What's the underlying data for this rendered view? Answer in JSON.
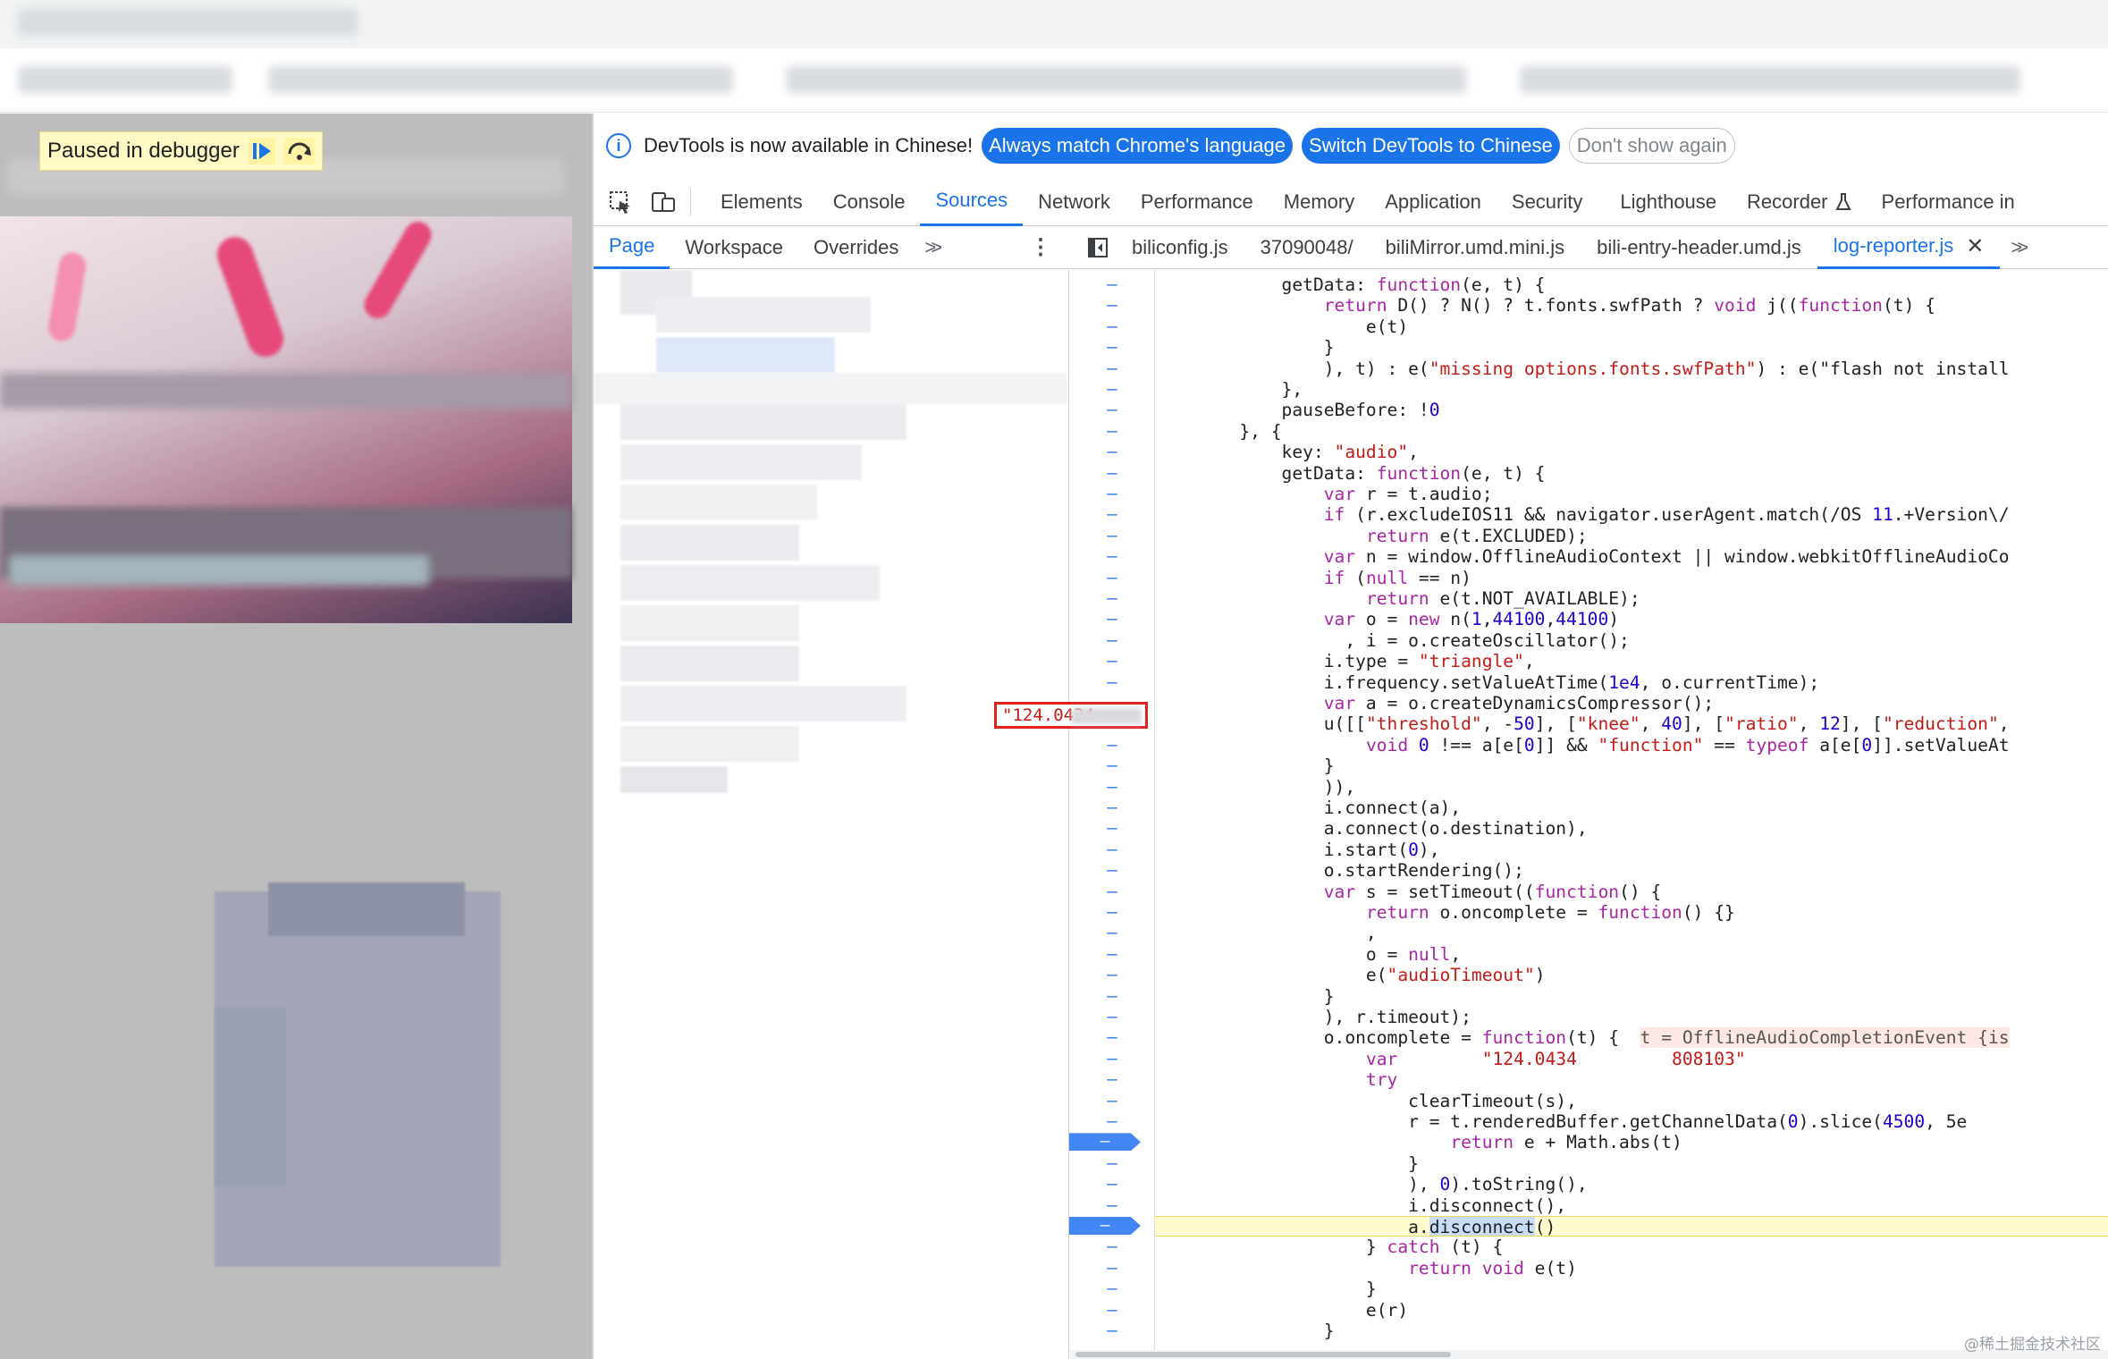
{
  "debugger_badge": {
    "label": "Paused in debugger"
  },
  "infobar": {
    "message": "DevTools is now available in Chinese!",
    "button_match": "Always match Chrome's language",
    "button_switch": "Switch DevTools to Chinese",
    "button_dismiss": "Don't show again"
  },
  "main_tabs": [
    "Elements",
    "Console",
    "Sources",
    "Network",
    "Performance",
    "Memory",
    "Application",
    "Security",
    "Lighthouse",
    "Recorder",
    "Performance in"
  ],
  "main_tabs_active": "Sources",
  "nav_tabs": [
    "Page",
    "Workspace",
    "Overrides"
  ],
  "nav_tabs_active": "Page",
  "file_tabs": [
    "biliconfig.js",
    "37090048/",
    "biliMirror.umd.mini.js",
    "bili-entry-header.umd.js",
    "log-reporter.js"
  ],
  "file_tabs_active": "log-reporter.js",
  "gutter_symbol": "–",
  "code_lines": [
    "            getData: function(e, t) {",
    "                return D() ? N() ? t.fonts.swfPath ? void j((function(t) {",
    "                    e(t)",
    "                }",
    "                ), t) : e(\"missing options.fonts.swfPath\") : e(\"flash not install",
    "            },",
    "            pauseBefore: !0",
    "        }, {",
    "            key: \"audio\",",
    "            getData: function(e, t) {",
    "                var r = t.audio;",
    "                if (r.excludeIOS11 && navigator.userAgent.match(/OS 11.+Version\\/",
    "                    return e(t.EXCLUDED);",
    "                var n = window.OfflineAudioContext || window.webkitOfflineAudioCo",
    "                if (null == n)",
    "                    return e(t.NOT_AVAILABLE);",
    "                var o = new n(1,44100,44100)",
    "                  , i = o.createOscillator();",
    "                i.type = \"triangle\",",
    "                i.frequency.setValueAtTime(1e4, o.currentTime);",
    "                var a = o.createDynamicsCompressor();",
    "                u([[\"threshold\", -50], [\"knee\", 40], [\"ratio\", 12], [\"reduction\",",
    "                    void 0 !== a[e[0]] && \"function\" == typeof a[e[0]].setValueAt",
    "                }",
    "                )),",
    "                i.connect(a),",
    "                a.connect(o.destination),",
    "                i.start(0),",
    "                o.startRendering();",
    "                var s = setTimeout((function() {",
    "                    return o.oncomplete = function() {}",
    "                    ,",
    "                    o = null,",
    "                    e(\"audioTimeout\")",
    "                }",
    "                ), r.timeout);",
    "                o.oncomplete = function(t) {  t = OfflineAudioCompletionEvent {is",
    "                    var        \"124.0434         808103\"",
    "                    try",
    "                        clearTimeout(s),",
    "                        r = t.renderedBuffer.getChannelData(0).slice(4500, 5e",
    "                            return e + Math.abs(t)",
    "                        }",
    "                        ), 0).toString(),",
    "                        i.disconnect(),",
    "                        a.disconnect()",
    "                    } catch (t) {",
    "                        return void e(t)",
    "                    }",
    "                    e(r)",
    "                }"
  ],
  "tooltip_value": "\"124.0434",
  "watermark": "@稀土掘金技术社区",
  "colors": {
    "accent": "#1a73e8",
    "highlight_line": "#fffbcf",
    "tooltip_border": "#e02020"
  }
}
